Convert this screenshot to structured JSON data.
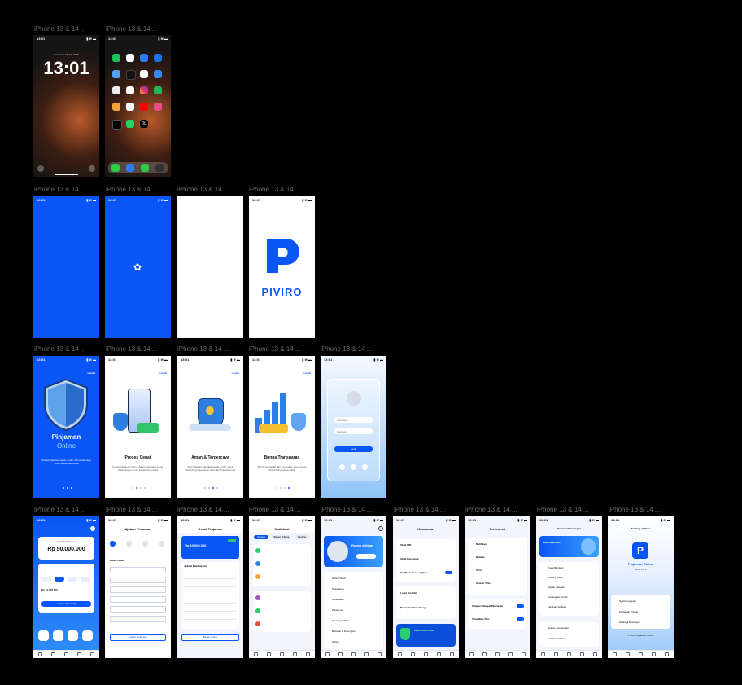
{
  "frame_label": "iPhone 13 & 14 ...",
  "status_time": "13:01",
  "lock": {
    "date": "Saturday, 17 July 2026",
    "time": "13:01"
  },
  "splash": {
    "brand": "PIVIRO"
  },
  "onboarding": [
    {
      "title": "Pinjaman",
      "subtitle": "Online",
      "text": "Solusi pinjaman cepat, aman, dan terpercaya untuk kebutuhan Anda",
      "skip": "Lewati"
    },
    {
      "title": "Proses Cepat",
      "text": "Ajukan pinjaman hanya dalam beberapa menit. Data langsung cair ke rekening anda",
      "skip": "Lewati"
    },
    {
      "title": "Aman & Terpercaya",
      "text": "Kami diawasi dan diawasi oleh OJK untuk melindungi keamanan data dan finansial anda",
      "skip": "Lewati"
    },
    {
      "title": "Bunga Transparan",
      "text": "Bunga kompetitif dan transparan tanpa biaya tersembunyi sama sekali",
      "skip": "Lewati"
    }
  ],
  "login": {
    "user_placeholder": "Username",
    "pass_placeholder": "Password",
    "button": "Login"
  },
  "home": {
    "label": "Jumlah Pinjaman",
    "amount": "Rp 50.000.000",
    "button": "Ajukan Sekarang",
    "amount2": "Rp 10.000.000"
  },
  "screens": {
    "ajukan": "Ajukan Pinjaman",
    "ajukan_section": "Data Pribadi",
    "ajukan_button": "Ajukan Sekarang",
    "detail": "Detail Pinjaman",
    "detail_amount": "Rp 10.000.000",
    "detail_section": "Jadwal Pembayaran",
    "detail_button": "Bayar Cicilan",
    "notif": "Notifikasi",
    "notif_tabs": [
      "Semua",
      "Belum Dibaca",
      "Penting"
    ],
    "profile_name": "Revan william",
    "profile_items": [
      "Data Pribadi",
      "Keamanan",
      "Kartu Bank",
      "Preferensi",
      "Tentang Aplikasi",
      "Bantuan & Dukungan",
      "Keluar"
    ],
    "keamanan": "Keamanan",
    "keamanan_items": [
      "Ubah PIN",
      "Ubah Password",
      "Verifikasi Dua Langkah",
      "Login Terakhir",
      "Perangkat Terhubung"
    ],
    "keamanan_badge": "Akun Anda Aman",
    "preferensi": "Preferensi",
    "pref_items": [
      "Notifikasi",
      "Bahasa",
      "Tema",
      "Ukuran Teks",
      "Simpan Riwayat Pencarian",
      "Tampilkan Tips"
    ],
    "bantuan": "Bantuan&Dukungan",
    "bantuan_banner": "Butuh Bantuan?",
    "bantuan_items": [
      "Pusat Bantuan",
      "Hubungi Kami",
      "Ajukan Keluhan",
      "Pertanyaan Umum",
      "Panduan Aplikasi",
      "Syarat & Ketentuan",
      "Kebijakan Privasi"
    ],
    "tentang": "Tentang Aplikasi",
    "tentang_app": "Pinjaman Online",
    "tentang_version": "Versi 2.0.0",
    "tentang_items": [
      "Syarat Layanan",
      "Kebijakan Privasi",
      "Hubungi Developer"
    ],
    "tentang_footer": "© 2024 Pinjaman Online"
  },
  "colors": {
    "primary": "#0a55f5",
    "background": "#000000",
    "label": "#6b6b6b"
  }
}
